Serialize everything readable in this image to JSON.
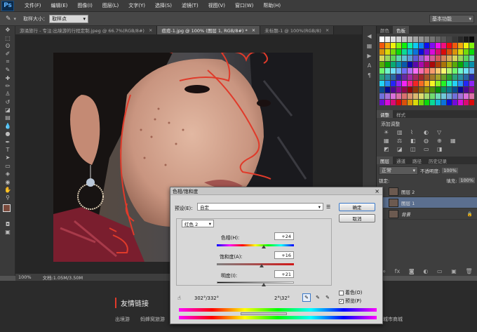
{
  "app": {
    "logo": "Ps"
  },
  "menu": [
    "文件(F)",
    "编辑(E)",
    "图像(I)",
    "图层(L)",
    "文字(Y)",
    "选择(S)",
    "滤镜(T)",
    "视图(V)",
    "窗口(W)",
    "帮助(H)"
  ],
  "options": {
    "sample_size_label": "取样大小：",
    "sample_size_value": "取样点",
    "workspace": "基本功能"
  },
  "tabs": [
    {
      "label": "游涌旅行 - 专注:出境游的行程定制.jpeg @ 66.7%(RGB/8#)",
      "close": "×"
    },
    {
      "label": "痘痘-1.jpg @ 100% (图层 1, RGB/8#) *",
      "close": "×"
    },
    {
      "label": "未标题-1 @ 100%(RGB/8)",
      "close": "×"
    }
  ],
  "status": {
    "zoom": "100%",
    "doc": "文档:1.05M/3.50M"
  },
  "right_panels": {
    "swatch_tabs": [
      "颜色",
      "色板"
    ],
    "adjust_tabs": [
      "调整",
      "样式"
    ],
    "adjust_hint": "添加调整",
    "layer_tabs": [
      "图层",
      "通道",
      "路径",
      "历史记录"
    ],
    "blend_mode": "正常",
    "opacity_label": "不透明度:",
    "opacity_value": "100%",
    "fill_label": "填充:",
    "fill_value": "100%",
    "lock_label": "锁定:",
    "layers": [
      {
        "name": "图层 2"
      },
      {
        "name": "图层 1"
      },
      {
        "name": "背景"
      }
    ]
  },
  "dialog": {
    "title": "色相/饱和度",
    "close": "×",
    "preset_label": "预设(E):",
    "preset_value": "自定",
    "ok": "确定",
    "cancel": "取消",
    "channel": "红色 2",
    "hue_label": "色相(H):",
    "hue_value": "+24",
    "sat_label": "饱和度(A):",
    "sat_value": "+16",
    "light_label": "明度(I):",
    "light_value": "+21",
    "range_left": "302°/332°",
    "range_right": "2°\\32°",
    "colorize": "着色(O)",
    "preview": "预览(P)"
  },
  "web": {
    "heading": "友情链接",
    "links": [
      "出境游",
      "蚂蜂窝旅游",
      "城市商城"
    ]
  },
  "colors": {
    "accent_red": "#e03a2a",
    "dialog_bg": "#d8d8d8",
    "app_bg": "#535353"
  }
}
